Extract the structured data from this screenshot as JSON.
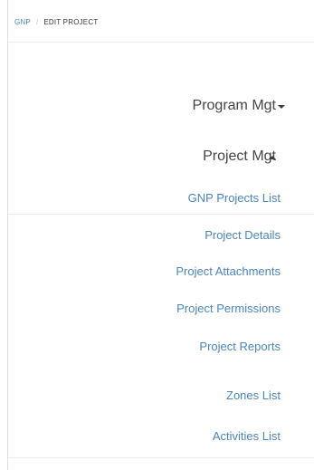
{
  "breadcrumb": {
    "root": "GNP",
    "separator": "/",
    "current": "EDIT PROJECT"
  },
  "menu": {
    "program_mgt": {
      "label": "Program Mgt",
      "expanded": false,
      "caret_icon": "caret-down-icon"
    },
    "project_mgt": {
      "label": "Project Mgt",
      "expanded": true,
      "caret_icon": "caret-up-icon"
    },
    "projects_list": "GNP Projects List",
    "project_items": [
      "Project Details",
      "Project Attachments",
      "Project Permissions",
      "Project Reports",
      "Zones List",
      "Activities List"
    ]
  },
  "colors": {
    "link": "#4a86c0",
    "text": "#454545",
    "divider": "#ececec"
  }
}
